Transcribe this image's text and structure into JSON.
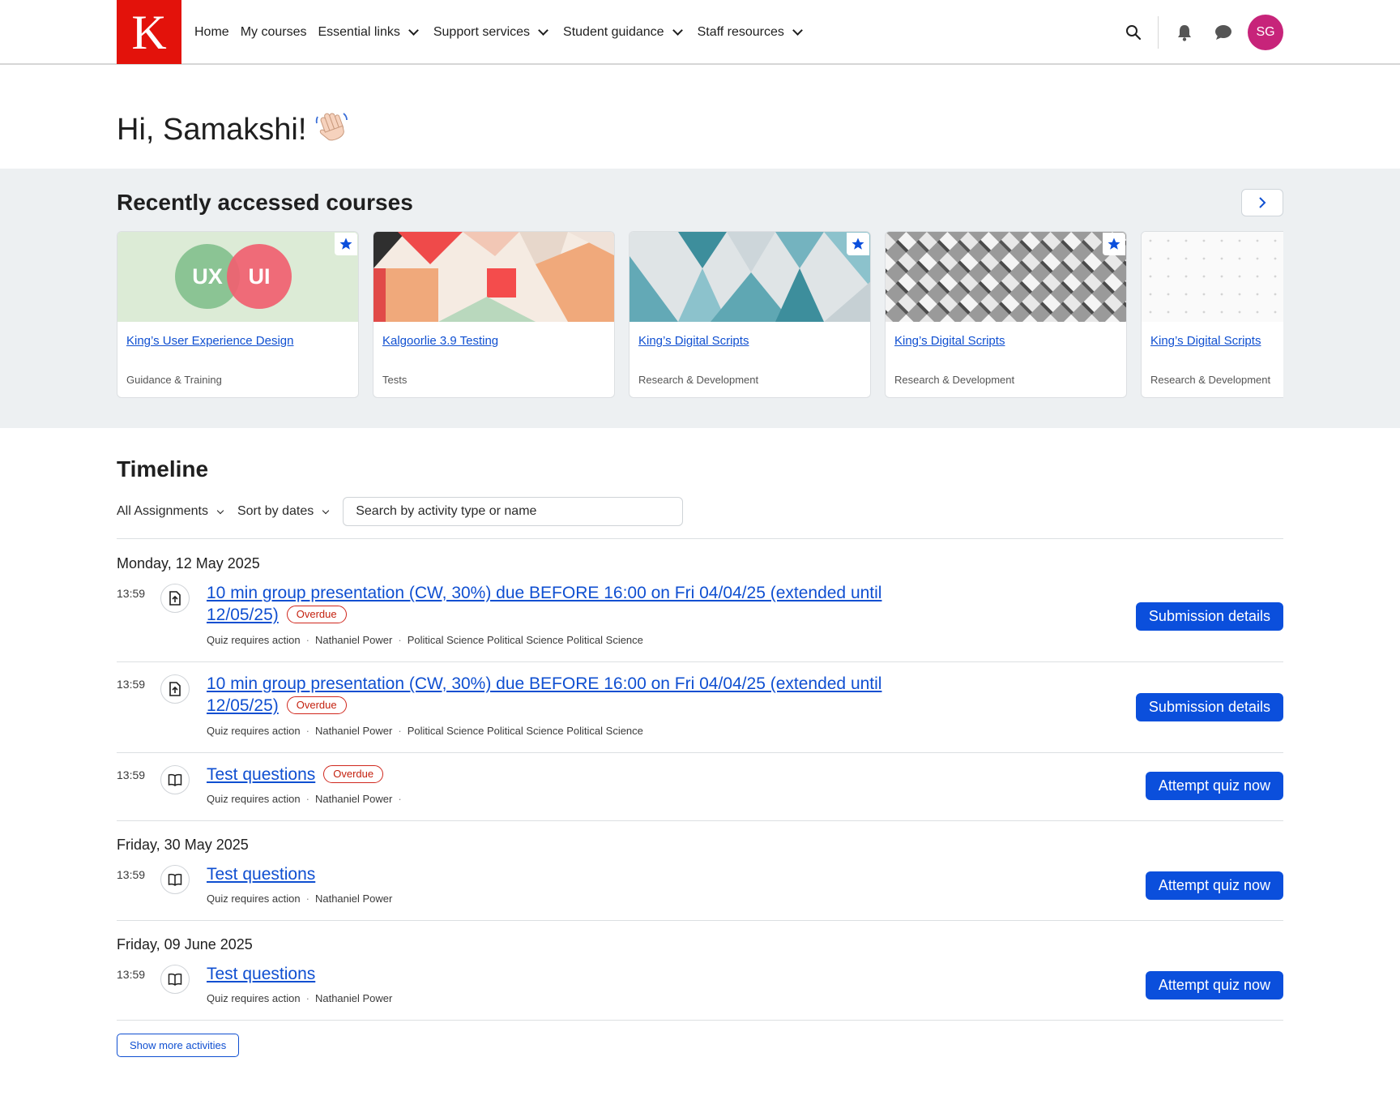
{
  "header": {
    "logo_letter": "K",
    "nav": [
      {
        "label": "Home",
        "has_dropdown": false
      },
      {
        "label": "My courses",
        "has_dropdown": false
      },
      {
        "label": "Essential links",
        "has_dropdown": true
      },
      {
        "label": "Support services",
        "has_dropdown": true
      },
      {
        "label": "Student guidance",
        "has_dropdown": true
      },
      {
        "label": "Staff resources",
        "has_dropdown": true
      }
    ],
    "icons": [
      "search-icon",
      "bell-icon",
      "chat-icon"
    ],
    "avatar_initials": "SG",
    "avatar_color": "#c7247a",
    "brand_color": "#e3120b"
  },
  "greeting": {
    "text": "Hi, Samakshi!",
    "emoji": "👋🏻"
  },
  "recent": {
    "title": "Recently accessed courses",
    "courses": [
      {
        "title": "King’s User Experience Design",
        "category": "Guidance & Training",
        "starred": true,
        "image": "ux-ui-venn",
        "venn_left": "UX",
        "venn_right": "UI"
      },
      {
        "title": "Kalgoorlie 3.9 Testing",
        "category": "Tests",
        "starred": false,
        "image": "geometric-blocks"
      },
      {
        "title": "King’s Digital Scripts",
        "category": "Research & Development",
        "starred": true,
        "image": "teal-triangles"
      },
      {
        "title": "King’s Digital Scripts",
        "category": "Research & Development",
        "starred": true,
        "image": "grey-chevrons"
      },
      {
        "title": "King’s Digital Scripts",
        "category": "Research & Development",
        "starred": false,
        "image": "dot-grid"
      }
    ]
  },
  "timeline": {
    "title": "Timeline",
    "filter_label": "All Assignments",
    "sort_label": "Sort by dates",
    "search_placeholder": "Search by activity type or name",
    "days": [
      {
        "date": "Monday, 12 May 2025",
        "items": [
          {
            "time": "13:59",
            "icon": "file-upload-icon",
            "title": "10 min group presentation (CW, 30%) due BEFORE 16:00 on Fri 04/04/25 (extended until 12/05/25)",
            "badge": "Overdue",
            "meta": [
              "Quiz requires action",
              "Nathaniel Power",
              "Political Science Political Science Political Science"
            ],
            "action": "Submission details"
          },
          {
            "time": "13:59",
            "icon": "file-upload-icon",
            "title": "10 min group presentation (CW, 30%) due BEFORE 16:00 on Fri 04/04/25 (extended until 12/05/25)",
            "badge": "Overdue",
            "meta": [
              "Quiz requires action",
              "Nathaniel Power",
              "Political Science Political Science Political Science"
            ],
            "action": "Submission details"
          },
          {
            "time": "13:59",
            "icon": "book-icon",
            "title": "Test questions",
            "badge": "Overdue",
            "meta": [
              "Quiz requires action",
              "Nathaniel Power",
              ""
            ],
            "action": "Attempt quiz now"
          }
        ]
      },
      {
        "date": "Friday, 30 May 2025",
        "items": [
          {
            "time": "13:59",
            "icon": "book-icon",
            "title": "Test questions",
            "badge": "",
            "meta": [
              "Quiz requires action",
              "Nathaniel Power"
            ],
            "action": "Attempt quiz now"
          }
        ]
      },
      {
        "date": "Friday, 09 June 2025",
        "items": [
          {
            "time": "13:59",
            "icon": "book-icon",
            "title": "Test questions",
            "badge": "",
            "meta": [
              "Quiz requires action",
              "Nathaniel Power"
            ],
            "action": "Attempt quiz now"
          }
        ]
      }
    ],
    "show_more": "Show more activities"
  },
  "colors": {
    "link": "#0f4fd1",
    "primary_button": "#0b4fdc",
    "overdue": "#c4210f",
    "band_bg": "#edf0f2"
  }
}
